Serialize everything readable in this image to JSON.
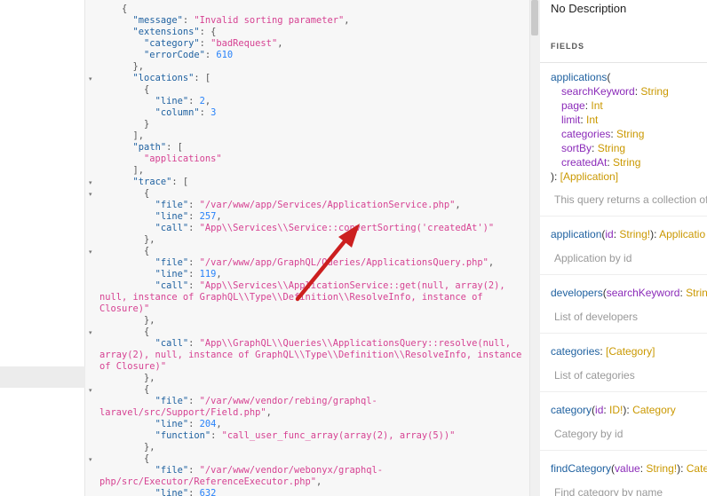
{
  "result": {
    "lines": [
      {
        "i": "    ",
        "t": [
          [
            "p",
            "{"
          ]
        ]
      },
      {
        "i": "      ",
        "t": [
          [
            "key",
            "\"message\""
          ],
          [
            "p",
            ": "
          ],
          [
            "str",
            "\"Invalid sorting parameter\""
          ],
          [
            "p",
            ","
          ]
        ]
      },
      {
        "i": "      ",
        "t": [
          [
            "key",
            "\"extensions\""
          ],
          [
            "p",
            ": {"
          ]
        ]
      },
      {
        "i": "        ",
        "t": [
          [
            "key",
            "\"category\""
          ],
          [
            "p",
            ": "
          ],
          [
            "str",
            "\"badRequest\""
          ],
          [
            "p",
            ","
          ]
        ]
      },
      {
        "i": "        ",
        "t": [
          [
            "key",
            "\"errorCode\""
          ],
          [
            "p",
            ": "
          ],
          [
            "num",
            "610"
          ]
        ]
      },
      {
        "i": "      ",
        "t": [
          [
            "p",
            "},"
          ]
        ]
      },
      {
        "i": "      ",
        "t": [
          [
            "key",
            "\"locations\""
          ],
          [
            "p",
            ": ["
          ]
        ]
      },
      {
        "i": "        ",
        "t": [
          [
            "p",
            "{"
          ]
        ]
      },
      {
        "i": "          ",
        "t": [
          [
            "key",
            "\"line\""
          ],
          [
            "p",
            ": "
          ],
          [
            "num",
            "2"
          ],
          [
            "p",
            ","
          ]
        ]
      },
      {
        "i": "          ",
        "t": [
          [
            "key",
            "\"column\""
          ],
          [
            "p",
            ": "
          ],
          [
            "num",
            "3"
          ]
        ]
      },
      {
        "i": "        ",
        "t": [
          [
            "p",
            "}"
          ]
        ]
      },
      {
        "i": "      ",
        "t": [
          [
            "p",
            "],"
          ]
        ]
      },
      {
        "i": "      ",
        "t": [
          [
            "key",
            "\"path\""
          ],
          [
            "p",
            ": ["
          ]
        ]
      },
      {
        "i": "        ",
        "t": [
          [
            "str",
            "\"applications\""
          ]
        ]
      },
      {
        "i": "      ",
        "t": [
          [
            "p",
            "],"
          ]
        ]
      },
      {
        "i": "      ",
        "t": [
          [
            "key",
            "\"trace\""
          ],
          [
            "p",
            ": ["
          ]
        ]
      },
      {
        "i": "        ",
        "t": [
          [
            "p",
            "{"
          ]
        ]
      },
      {
        "i": "          ",
        "t": [
          [
            "key",
            "\"file\""
          ],
          [
            "p",
            ": "
          ],
          [
            "str",
            "\"/var/www/app/Services/ApplicationService.php\""
          ],
          [
            "p",
            ","
          ]
        ]
      },
      {
        "i": "          ",
        "t": [
          [
            "key",
            "\"line\""
          ],
          [
            "p",
            ": "
          ],
          [
            "num",
            "257"
          ],
          [
            "p",
            ","
          ]
        ]
      },
      {
        "i": "          ",
        "t": [
          [
            "key",
            "\"call\""
          ],
          [
            "p",
            ": "
          ],
          [
            "str",
            "\"App\\\\Services\\\\Service::convertSorting('createdAt')\""
          ]
        ]
      },
      {
        "i": "        ",
        "t": [
          [
            "p",
            "},"
          ]
        ]
      },
      {
        "i": "        ",
        "t": [
          [
            "p",
            "{"
          ]
        ]
      },
      {
        "i": "          ",
        "t": [
          [
            "key",
            "\"file\""
          ],
          [
            "p",
            ": "
          ],
          [
            "str",
            "\"/var/www/app/GraphQL/Queries/ApplicationsQuery.php\""
          ],
          [
            "p",
            ","
          ]
        ]
      },
      {
        "i": "          ",
        "t": [
          [
            "key",
            "\"line\""
          ],
          [
            "p",
            ": "
          ],
          [
            "num",
            "119"
          ],
          [
            "p",
            ","
          ]
        ]
      },
      {
        "i": "          ",
        "t": [
          [
            "key",
            "\"call\""
          ],
          [
            "p",
            ": "
          ],
          [
            "str",
            "\"App\\\\Services\\\\ApplicationService::get(null, array(2),"
          ]
        ]
      },
      {
        "i": "",
        "t": [
          [
            "str",
            "null, instance of GraphQL\\\\Type\\\\Definition\\\\ResolveInfo, instance of"
          ]
        ]
      },
      {
        "i": "",
        "t": [
          [
            "str",
            "Closure)\""
          ]
        ]
      },
      {
        "i": "        ",
        "t": [
          [
            "p",
            "},"
          ]
        ]
      },
      {
        "i": "        ",
        "t": [
          [
            "p",
            "{"
          ]
        ]
      },
      {
        "i": "          ",
        "t": [
          [
            "key",
            "\"call\""
          ],
          [
            "p",
            ": "
          ],
          [
            "str",
            "\"App\\\\GraphQL\\\\Queries\\\\ApplicationsQuery::resolve(null,"
          ]
        ]
      },
      {
        "i": "",
        "t": [
          [
            "str",
            "array(2), null, instance of GraphQL\\\\Type\\\\Definition\\\\ResolveInfo, instance"
          ]
        ]
      },
      {
        "i": "",
        "t": [
          [
            "str",
            "of Closure)\""
          ]
        ]
      },
      {
        "i": "        ",
        "t": [
          [
            "p",
            "},"
          ]
        ]
      },
      {
        "i": "        ",
        "t": [
          [
            "p",
            "{"
          ]
        ]
      },
      {
        "i": "          ",
        "t": [
          [
            "key",
            "\"file\""
          ],
          [
            "p",
            ": "
          ],
          [
            "str",
            "\"/var/www/vendor/rebing/graphql-"
          ]
        ]
      },
      {
        "i": "",
        "t": [
          [
            "str",
            "laravel/src/Support/Field.php\""
          ],
          [
            "p",
            ","
          ]
        ]
      },
      {
        "i": "          ",
        "t": [
          [
            "key",
            "\"line\""
          ],
          [
            "p",
            ": "
          ],
          [
            "num",
            "204"
          ],
          [
            "p",
            ","
          ]
        ]
      },
      {
        "i": "          ",
        "t": [
          [
            "key",
            "\"function\""
          ],
          [
            "p",
            ": "
          ],
          [
            "str",
            "\"call_user_func_array(array(2), array(5))\""
          ]
        ]
      },
      {
        "i": "        ",
        "t": [
          [
            "p",
            "},"
          ]
        ]
      },
      {
        "i": "        ",
        "t": [
          [
            "p",
            "{"
          ]
        ]
      },
      {
        "i": "          ",
        "t": [
          [
            "key",
            "\"file\""
          ],
          [
            "p",
            ": "
          ],
          [
            "str",
            "\"/var/www/vendor/webonyx/graphql-"
          ]
        ]
      },
      {
        "i": "",
        "t": [
          [
            "str",
            "php/src/Executor/ReferenceExecutor.php\""
          ],
          [
            "p",
            ","
          ]
        ]
      },
      {
        "i": "          ",
        "t": [
          [
            "key",
            "\"line\""
          ],
          [
            "p",
            ": "
          ],
          [
            "num",
            "632"
          ]
        ]
      }
    ],
    "fold_markers": [
      {
        "glyph": "▾",
        "line": -1
      },
      {
        "glyph": "▾",
        "line": 6
      },
      {
        "glyph": "▾",
        "line": 15
      },
      {
        "glyph": "▾",
        "line": 16
      },
      {
        "glyph": "▾",
        "line": 21
      },
      {
        "glyph": "▾",
        "line": 28
      },
      {
        "glyph": "▾",
        "line": 33
      },
      {
        "glyph": "▾",
        "line": 39
      }
    ]
  },
  "docs": {
    "description": "No Description",
    "fields_title": "FIELDS",
    "applications": {
      "name": "applications",
      "open": "(",
      "args": [
        {
          "name": "searchKeyword",
          "type": "String"
        },
        {
          "name": "page",
          "type": "Int"
        },
        {
          "name": "limit",
          "type": "Int"
        },
        {
          "name": "categories",
          "type": "String"
        },
        {
          "name": "sortBy",
          "type": "String"
        },
        {
          "name": "createdAt",
          "type": "String"
        }
      ],
      "close": "): ",
      "return_type": "[Application]",
      "desc": "This query returns a collection of"
    },
    "fields": [
      {
        "name": "application",
        "sig": "(",
        "arg": "id",
        "argtype": "String!",
        "rest": "): ",
        "type": "Applicatio",
        "desc": "Application by id"
      },
      {
        "name": "developers",
        "sig": "(",
        "arg": "searchKeyword",
        "argtype": "String",
        "rest": "",
        "type": "",
        "desc": "List of developers"
      },
      {
        "name": "categories",
        "sig": "",
        "arg": "",
        "argtype": "",
        "rest": ": ",
        "type": "[Category]",
        "desc": "List of categories"
      },
      {
        "name": "category",
        "sig": "(",
        "arg": "id",
        "argtype": "ID!",
        "rest": "): ",
        "type": "Category",
        "desc": "Category by id"
      },
      {
        "name": "findCategory",
        "sig": "(",
        "arg": "value",
        "argtype": "String!",
        "rest": "): ",
        "type": "Cate",
        "desc": "Find category by name"
      }
    ]
  },
  "colors": {
    "key": "#1f61a0",
    "string": "#d64292",
    "number": "#2882f9",
    "type": "#ca9800",
    "arrow": "#cc1f1f"
  }
}
